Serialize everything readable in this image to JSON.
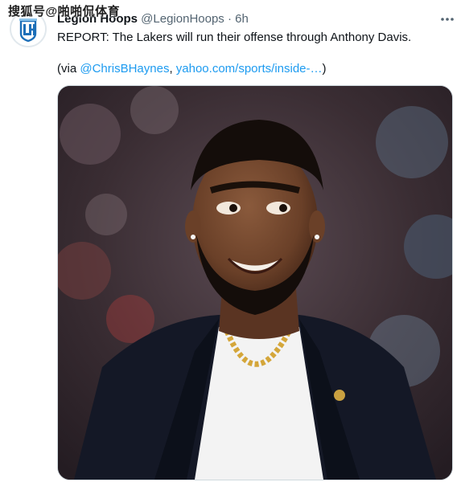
{
  "watermark": {
    "text": "搜狐号@啪啪侃体育"
  },
  "tweet": {
    "display_name": "Legion Hoops",
    "handle": "@LegionHoops",
    "separator": "·",
    "time": "6h",
    "text": "REPORT: The Lakers will run their offense through Anthony Davis.",
    "via_open": "(via ",
    "via_mention": "@ChrisBHaynes",
    "via_comma": ", ",
    "via_link": "yahoo.com/sports/inside-…",
    "via_close": ")",
    "avatar_icon": "legion-hoops-logo",
    "more_icon": "more-horizontal-icon",
    "media_subject": "player-photo"
  },
  "colors": {
    "link": "#1d9bf0",
    "muted": "#536471",
    "text": "#0f1419",
    "avatar_blue": "#1d6fb8"
  }
}
